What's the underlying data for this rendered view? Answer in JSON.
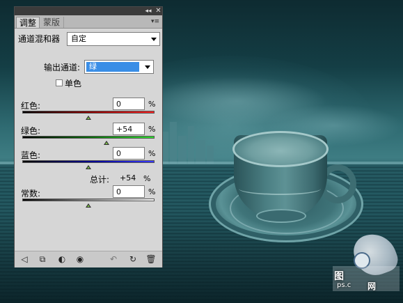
{
  "panel": {
    "tabs": [
      {
        "label": "调整"
      },
      {
        "label": "蒙版"
      }
    ],
    "preset": {
      "label": "通道混和器",
      "value": "自定"
    },
    "output_channel": {
      "label": "输出通道:",
      "value": "绿"
    },
    "monochrome": {
      "label": "单色",
      "checked": false
    },
    "channels": [
      {
        "label": "红色:",
        "value": "0",
        "unit": "%",
        "level": 0
      },
      {
        "label": "绿色:",
        "value": "+54",
        "unit": "%",
        "level": 54
      },
      {
        "label": "蓝色:",
        "value": "0",
        "unit": "%",
        "level": 0
      }
    ],
    "total": {
      "label": "总计:",
      "value": "+54",
      "unit": "%"
    },
    "constant": {
      "label": "常数:",
      "value": "0",
      "unit": "%",
      "level": 0
    },
    "footer_icons": [
      "back-arrow-icon",
      "expand-view-icon",
      "clip-layer-icon",
      "visibility-eye-icon",
      "previous-state-icon",
      "reset-icon",
      "delete-icon"
    ]
  },
  "watermark": {
    "line1": "图",
    "line2": "ps.c",
    "line3": "网"
  },
  "colors": {
    "panel_bg": "#d6d6d6",
    "selection": "#3a8ee6",
    "titlebar": "#3b3b3b"
  }
}
